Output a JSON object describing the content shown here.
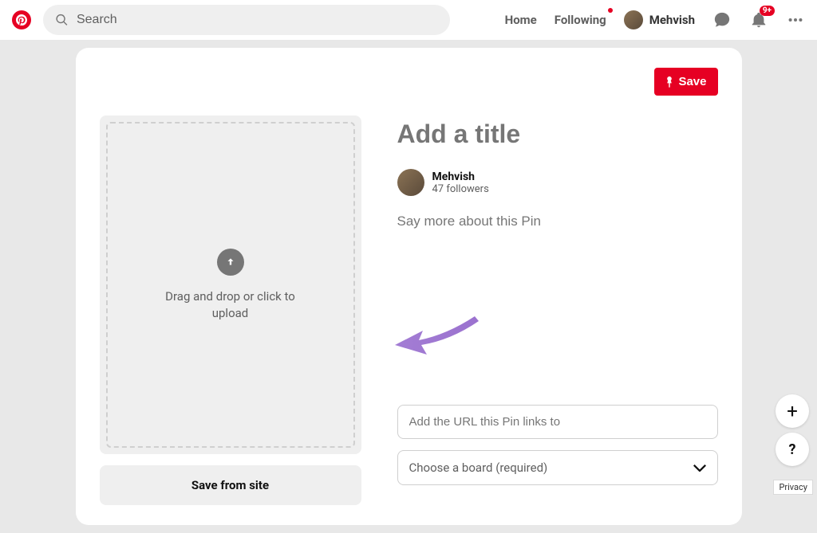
{
  "header": {
    "search_placeholder": "Search",
    "nav": {
      "home": "Home",
      "following": "Following"
    },
    "user_name": "Mehvish",
    "notification_badge": "9+"
  },
  "card": {
    "save_label": "Save",
    "upload_text": "Drag and drop or click to upload",
    "save_from_site_label": "Save from site",
    "title_placeholder": "Add a title",
    "user": {
      "name": "Mehvish",
      "followers": "47 followers"
    },
    "desc_placeholder": "Say more about this Pin",
    "url_placeholder": "Add the URL this Pin links to",
    "board_placeholder": "Choose a board (required)"
  },
  "floating": {
    "plus": "+",
    "help": "?",
    "privacy": "Privacy"
  }
}
